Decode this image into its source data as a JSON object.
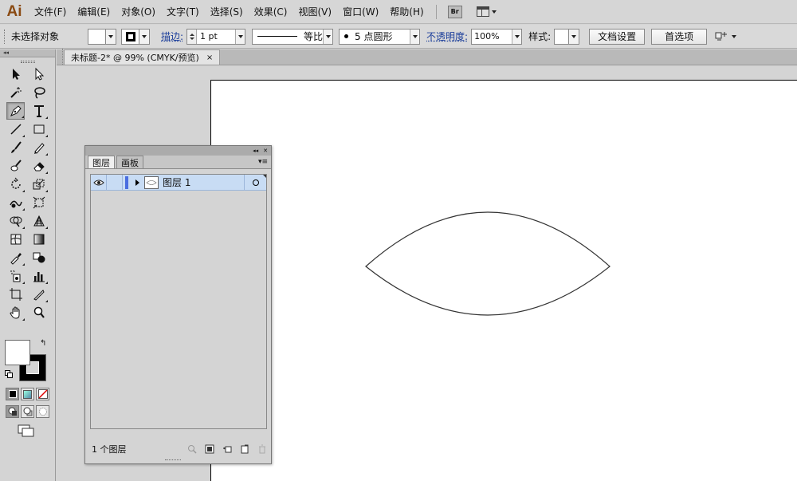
{
  "app": {
    "logo": "Ai"
  },
  "menubar": {
    "items": [
      "文件(F)",
      "编辑(E)",
      "对象(O)",
      "文字(T)",
      "选择(S)",
      "效果(C)",
      "视图(V)",
      "窗口(W)",
      "帮助(H)"
    ],
    "bridge_label": "Br"
  },
  "controlbar": {
    "selection_status": "未选择对象",
    "stroke_link": "描边:",
    "stroke_weight": "1 pt",
    "profile_label": "等比",
    "brush_label": "5 点圆形",
    "opacity_link": "不透明度:",
    "opacity_value": "100%",
    "style_label": "样式:",
    "doc_setup_button": "文档设置",
    "preferences_button": "首选项"
  },
  "document": {
    "tab_title": "未标题-2* @ 99% (CMYK/预览)",
    "tab_close": "×",
    "lens_shape": {
      "stroke": "#333333",
      "fill": "#ffffff"
    }
  },
  "layers_panel": {
    "tabs": [
      "图层",
      "画板"
    ],
    "layers": [
      {
        "name": "图层 1",
        "color": "#4a6ee0"
      }
    ],
    "footer_count": "1 个图层",
    "selection_color": "#c8dcf4"
  },
  "tools_panel": {
    "collapse_label": "◂◂"
  }
}
